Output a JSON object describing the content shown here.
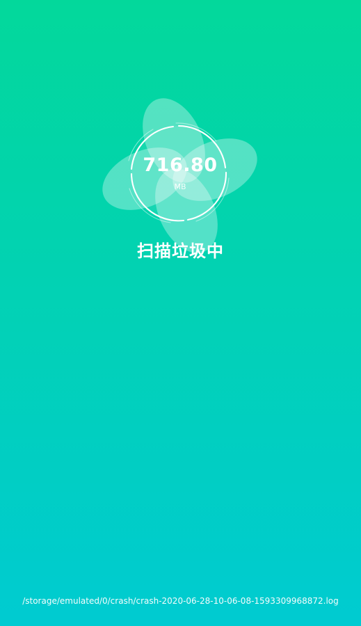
{
  "scan": {
    "size_value": "716.80",
    "size_unit": "MB",
    "status": "扫描垃圾中",
    "current_path": "/storage/emulated/0/crash/crash-2020-06-28-10-06-08-1593309968872.log"
  },
  "icons": {
    "fan": "fan-icon",
    "ring": "scan-ring-icon"
  },
  "colors": {
    "background_top": "#03d89b",
    "background_bottom": "#00cbd1",
    "foreground": "#ffffff"
  }
}
